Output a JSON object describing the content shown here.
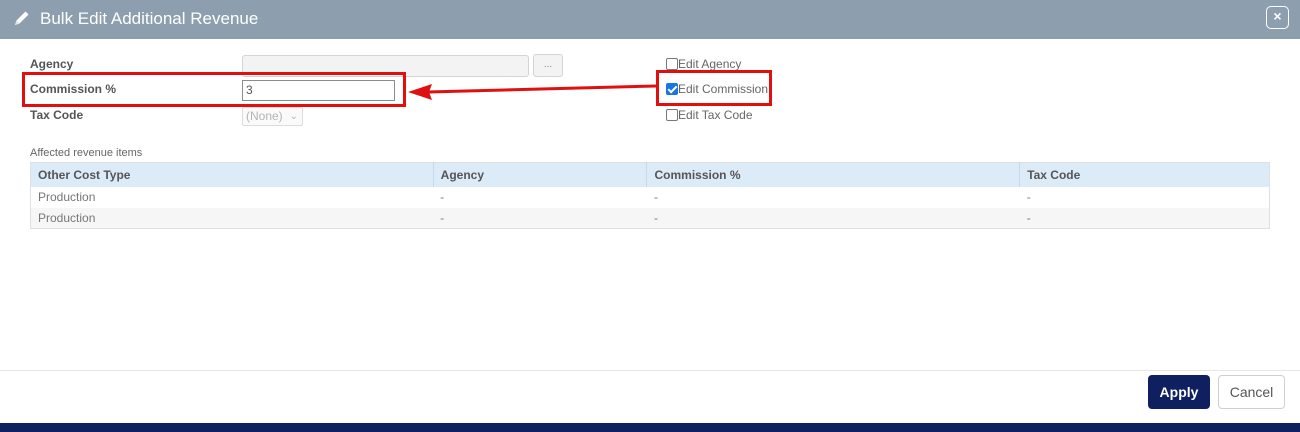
{
  "dialog": {
    "title": "Bulk Edit Additional Revenue",
    "close_glyph": "×"
  },
  "form": {
    "agency_label": "Agency",
    "agency_value": "",
    "browse_label": "...",
    "commission_label": "Commission %",
    "commission_value": "3",
    "tax_label": "Tax Code",
    "tax_value": "(None)"
  },
  "options": {
    "edit_agency": {
      "label": "Edit Agency",
      "checked": false
    },
    "edit_commission": {
      "label": "Edit Commission",
      "checked": true
    },
    "edit_tax": {
      "label": "Edit Tax Code",
      "checked": false
    }
  },
  "table": {
    "caption": "Affected revenue items",
    "headers": [
      "Other Cost Type",
      "Agency",
      "Commission %",
      "Tax Code"
    ],
    "rows": [
      [
        "Production",
        "-",
        "-",
        "-"
      ],
      [
        "Production",
        "-",
        "-",
        "-"
      ]
    ]
  },
  "footer": {
    "apply_label": "Apply",
    "cancel_label": "Cancel"
  },
  "colors": {
    "header_bg": "#8d9fae",
    "highlight": "#e01010",
    "primary_button": "#0f1f5f",
    "table_header_bg": "#dcebf8"
  }
}
